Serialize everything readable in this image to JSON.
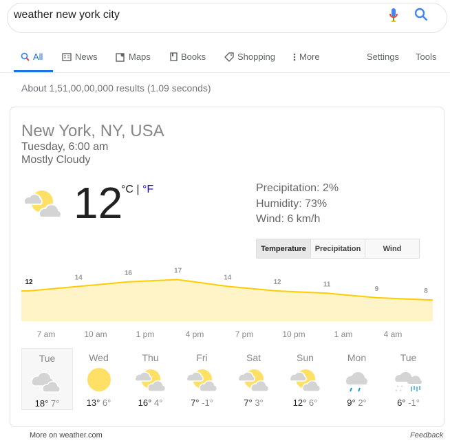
{
  "search": {
    "query": "weather new york city"
  },
  "tabs": [
    {
      "label": "All",
      "icon": "search-icon"
    },
    {
      "label": "News",
      "icon": "news-icon"
    },
    {
      "label": "Maps",
      "icon": "map-icon"
    },
    {
      "label": "Books",
      "icon": "book-icon"
    },
    {
      "label": "Shopping",
      "icon": "tag-icon"
    },
    {
      "label": "More",
      "icon": "dots-icon"
    }
  ],
  "tools": {
    "settings": "Settings",
    "tools": "Tools"
  },
  "stats": "About 1,51,00,00,000 results (1.09 seconds)",
  "weather": {
    "location": "New York, NY, USA",
    "time": "Tuesday, 6:00 am",
    "condition": "Mostly Cloudy",
    "temp": "12",
    "unit_c": "°C",
    "unit_sep": " | ",
    "unit_f": "°F",
    "precipitation": "Precipitation: 2%",
    "humidity": "Humidity: 73%",
    "wind": "Wind: 6 km/h",
    "segments": [
      "Temperature",
      "Precipitation",
      "Wind"
    ],
    "active_segment": "Temperature",
    "accent": "#ffcc00",
    "fill": "#fef4c8"
  },
  "chart_data": {
    "type": "area",
    "values": [
      12,
      14,
      16,
      17,
      14,
      12,
      11,
      9,
      8
    ],
    "labels": [
      "12",
      "14",
      "16",
      "17",
      "14",
      "12",
      "11",
      "9",
      "8"
    ],
    "hour_labels": [
      "7 am",
      "10 am",
      "1 pm",
      "4 pm",
      "7 pm",
      "10 pm",
      "1 am",
      "4 am"
    ]
  },
  "days": [
    {
      "name": "Tue",
      "hi": "18°",
      "lo": "7°",
      "icon": "cloudy-icon"
    },
    {
      "name": "Wed",
      "hi": "13°",
      "lo": "6°",
      "icon": "sun-icon"
    },
    {
      "name": "Thu",
      "hi": "16°",
      "lo": "4°",
      "icon": "partly-cloudy-icon"
    },
    {
      "name": "Fri",
      "hi": "7°",
      "lo": "-1°",
      "icon": "partly-cloudy-icon"
    },
    {
      "name": "Sat",
      "hi": "7°",
      "lo": "3°",
      "icon": "partly-cloudy-icon"
    },
    {
      "name": "Sun",
      "hi": "12°",
      "lo": "6°",
      "icon": "partly-cloudy-icon"
    },
    {
      "name": "Mon",
      "hi": "9°",
      "lo": "2°",
      "icon": "rain-icon"
    },
    {
      "name": "Tue",
      "hi": "6°",
      "lo": "-1°",
      "icon": "rain-snow-icon"
    }
  ],
  "footer": {
    "more": "More on weather.com",
    "feedback": "Feedback"
  }
}
